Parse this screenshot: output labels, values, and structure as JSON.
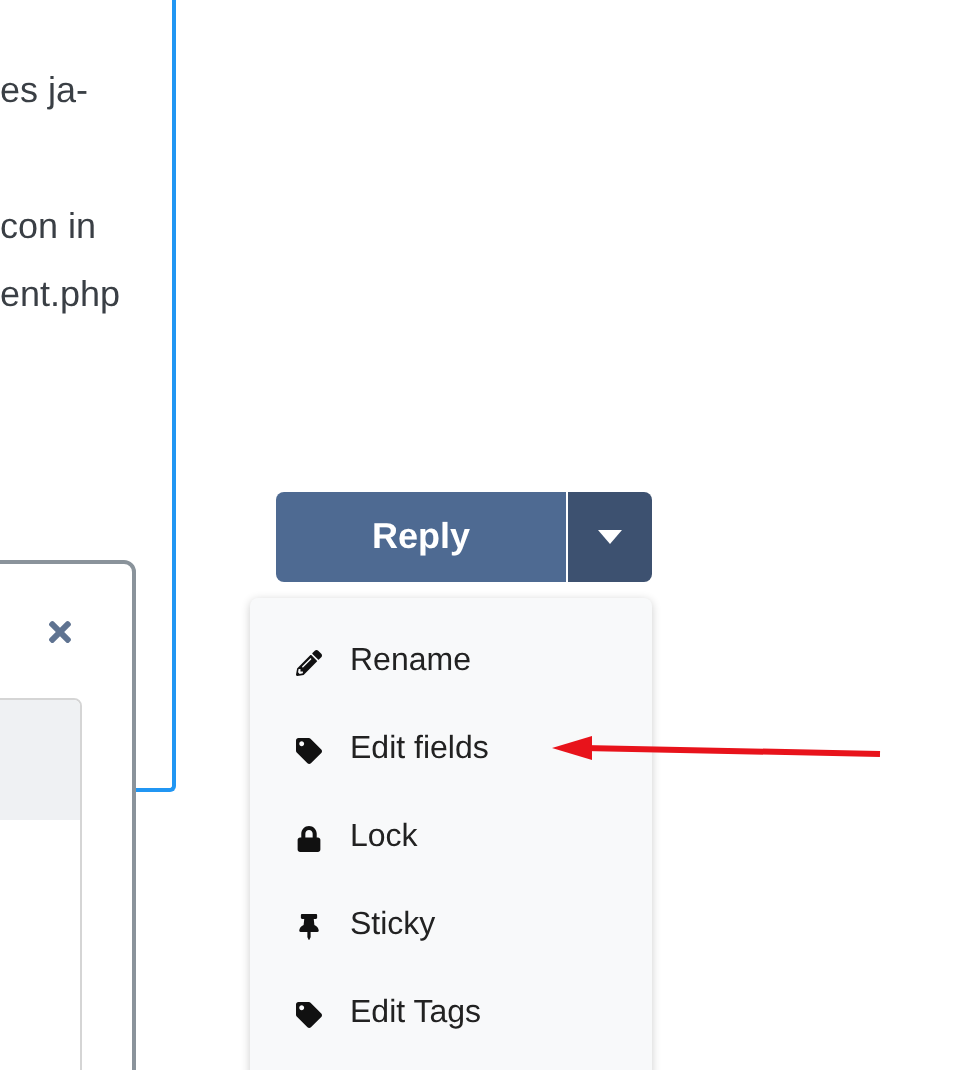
{
  "text_panel": {
    "paragraphs": [
      [
        "es ja-"
      ],
      [
        "con in",
        "ent.php"
      ]
    ]
  },
  "reply_button": {
    "label": "Reply"
  },
  "menu": {
    "items": [
      {
        "label": "Rename",
        "kind": "pencil"
      },
      {
        "label": "Edit fields",
        "kind": "tag"
      },
      {
        "label": "Lock",
        "kind": "lock"
      },
      {
        "label": "Sticky",
        "kind": "pin"
      },
      {
        "label": "Edit Tags",
        "kind": "tag"
      }
    ]
  }
}
